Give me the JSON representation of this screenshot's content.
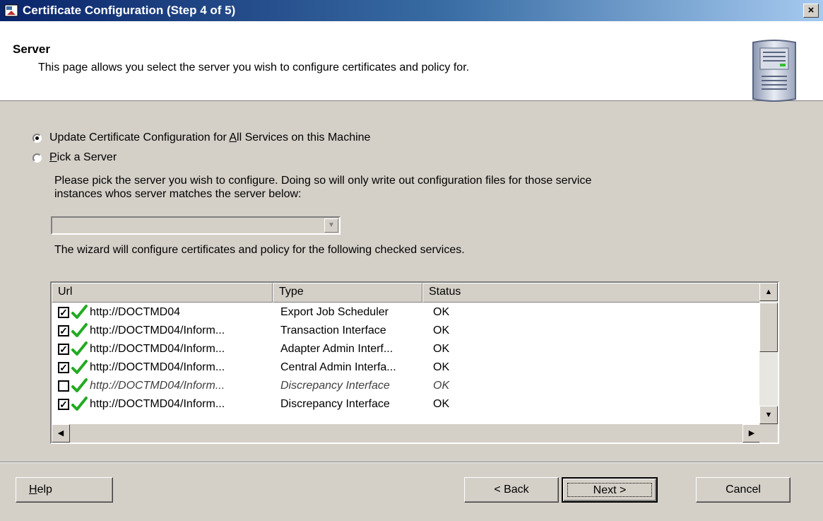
{
  "window": {
    "title": "Certificate Configuration (Step 4 of 5)",
    "close_label": "×"
  },
  "header": {
    "title": "Server",
    "description": "This page allows you select the server you wish to configure certificates and policy for."
  },
  "options": {
    "all_services_pre": "Update Certificate Configuration for ",
    "all_services_accel": "A",
    "all_services_post": "ll Services on this Machine",
    "pick_server_accel": "P",
    "pick_server_post": "ick a Server",
    "selected": "all_services"
  },
  "pick_help_line1": "Please pick the server you wish to configure.  Doing so will only write out configuration files for those service",
  "pick_help_line2": "instances whos server matches the server below:",
  "server_combo": {
    "value": ""
  },
  "checked_services_note": "The wizard will configure certificates and policy for the following checked services.",
  "services": {
    "columns": [
      "Url",
      "Type",
      "Status"
    ],
    "rows": [
      {
        "checked": "☑",
        "url": "http://DOCTMD04",
        "type": "Export Job Scheduler",
        "status": "OK",
        "enabled": true
      },
      {
        "checked": "☑",
        "url": "http://DOCTMD04/Inform...",
        "type": "Transaction Interface",
        "status": "OK",
        "enabled": true
      },
      {
        "checked": "☑",
        "url": "http://DOCTMD04/Inform...",
        "type": "Adapter Admin Interf...",
        "status": "OK",
        "enabled": true
      },
      {
        "checked": "☑",
        "url": "http://DOCTMD04/Inform...",
        "type": "Central Admin Interfa...",
        "status": "OK",
        "enabled": true
      },
      {
        "checked": "☐",
        "url": "http://DOCTMD04/Inform...",
        "type": "Discrepancy Interface",
        "status": "OK",
        "enabled": false
      },
      {
        "checked": "☑",
        "url": "http://DOCTMD04/Inform...",
        "type": "Discrepancy Interface",
        "status": "OK",
        "enabled": true
      }
    ]
  },
  "buttons": {
    "help_accel": "H",
    "help_rest": "elp",
    "back": "< Back",
    "next": "Next >",
    "cancel": "Cancel"
  },
  "colors": {
    "titlebar_start": "#0a246a",
    "titlebar_end": "#a6caf0",
    "check_green": "#22aa22"
  },
  "icons": [
    "app-icon",
    "close-icon",
    "server-icon",
    "checkmark-icon",
    "scroll-arrow-icon"
  ]
}
